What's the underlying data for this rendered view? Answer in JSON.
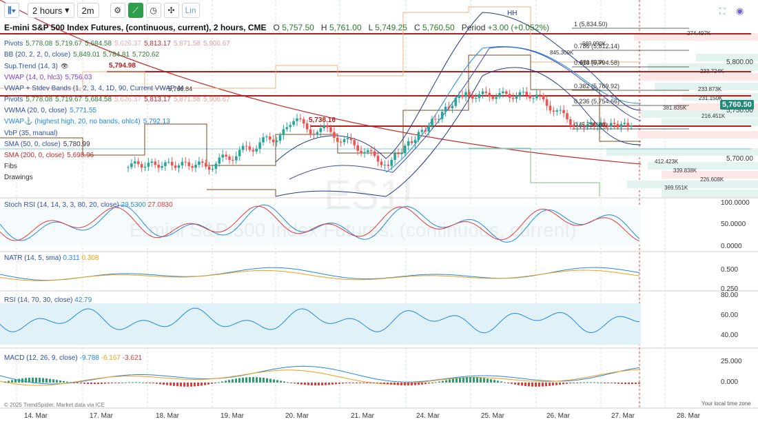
{
  "toolbar": {
    "chart_type_icon": "candles-icon",
    "interval": "2 hours",
    "interval2": "2m",
    "tools": [
      "gear-icon",
      "trend-tool-icon",
      "clock-icon",
      "crosshair-icon"
    ],
    "lin_label": "Lin"
  },
  "header": {
    "title": "E-mini S&P 500 Index Futures, (continuous, current), 2 hours, CME",
    "o_key": "O",
    "o_val": "5,757.50",
    "h_key": "H",
    "h_val": "5,761.00",
    "l_key": "L",
    "l_val": "5,749.25",
    "c_key": "C",
    "c_val": "5,760.50",
    "period_label": "Period",
    "period_val": "+3.00 (+0.052%)"
  },
  "legend": [
    {
      "label": "Pivots",
      "values": [
        "5,778.08",
        "5,719.67",
        "5,684.58",
        "5,626.37",
        "5,813.17",
        "5,871.58",
        "5,906.67"
      ]
    },
    {
      "label": "BB (20, 2, 2, 0, close)",
      "values": [
        "5,849.01",
        "5,784.81",
        "5,720.62"
      ]
    },
    {
      "label": "Sup.Trend (14, 3)",
      "values": []
    },
    {
      "label": "VWAP (14, 0, hlc3)",
      "values": [
        "5,756.03"
      ]
    },
    {
      "label": "VWAP + Stdev Bands (1, 2, 3, 4, 1D, 90, Current VWAP, M",
      "values": []
    },
    {
      "label": "Pivots",
      "values": [
        "5,778.08",
        "5,719.67",
        "5,684.58",
        "5,626.37",
        "5,813.17",
        "5,871.58",
        "5,906.67"
      ]
    },
    {
      "label": "VWMA (20, 0, close)",
      "values": [
        "5,771.55"
      ]
    },
    {
      "label": "VWAP⚓ (highest high, 20, no bands, ohlc4)",
      "values": [
        "5,792.13"
      ]
    },
    {
      "label": "VbP (35, manual)",
      "values": []
    },
    {
      "label": "SMA (50, 0, close)",
      "values": [
        "5,780.99"
      ]
    },
    {
      "label": "SMA (200, 0, close)",
      "values": [
        "5,698.96"
      ]
    },
    {
      "label": "Fibs",
      "values": []
    },
    {
      "label": "Drawings",
      "values": []
    }
  ],
  "levels": {
    "red1": "5,794.98",
    "red2": "5,738.16",
    "vwap_band_lbl": "5,769.84",
    "top_lbl": "5,834.50"
  },
  "fib_labels": [
    "1 (5,834.50)",
    "0.786 (5,812.14)",
    "0.618 (5,794.58)",
    "0.382 (5,769.92)",
    "0.236 (5,754.66)",
    "0 (5,730.00)"
  ],
  "volume_labels": [
    "274.497K",
    "669.090K",
    "845.309K",
    "681.533K",
    "233.724K",
    "233.873K",
    "231.150K",
    "381.835K",
    "216.451K",
    "412.423K",
    "339.838K",
    "226.608K",
    "369.551K"
  ],
  "price_axis": [
    "5,800.00",
    "5,750.00",
    "5,700.00"
  ],
  "current_price": "5,760.50",
  "hh_label": "HH",
  "panes": {
    "stoch": {
      "label": "Stoch RSI (14, 14, 3, 3, 80, 20, close)",
      "v1": "29.5300",
      "v2": "27.0830",
      "ticks": [
        "100.0000",
        "50.0000",
        "0.0000"
      ]
    },
    "natr": {
      "label": "NATR (14, 5, sma)",
      "v1": "0.311",
      "v2": "0.308",
      "ticks": [
        "0.500",
        "0.250"
      ]
    },
    "rsi": {
      "label": "RSI (14, 70, 30, close)",
      "v1": "42.79",
      "ticks": [
        "80.00",
        "60.00",
        "40.00"
      ]
    },
    "macd": {
      "label": "MACD (12, 26, 9, close)",
      "v1": "-9.788",
      "v2": "-6.167",
      "v3": "-3.621",
      "ticks": [
        "25.000",
        "0.000"
      ]
    }
  },
  "dates": [
    "14. Mar",
    "17. Mar",
    "18. Mar",
    "19. Mar",
    "20. Mar",
    "21. Mar",
    "24. Mar",
    "25. Mar",
    "26. Mar",
    "27. Mar",
    "28. Mar"
  ],
  "footer": {
    "copyright": "© 2025 TrendSpider. Market data via ICE",
    "local_time": "Your local time zone"
  },
  "watermark": {
    "big": "ES1!",
    "sub": "E-mini S&P 500 Index Futures, (continuous, current)"
  },
  "colors": {
    "up": "#26a69a",
    "down": "#ef5350",
    "red_level": "#b71c1c",
    "bb": "#1e3a8a",
    "rsi_fill": "#e0f2f7"
  }
}
